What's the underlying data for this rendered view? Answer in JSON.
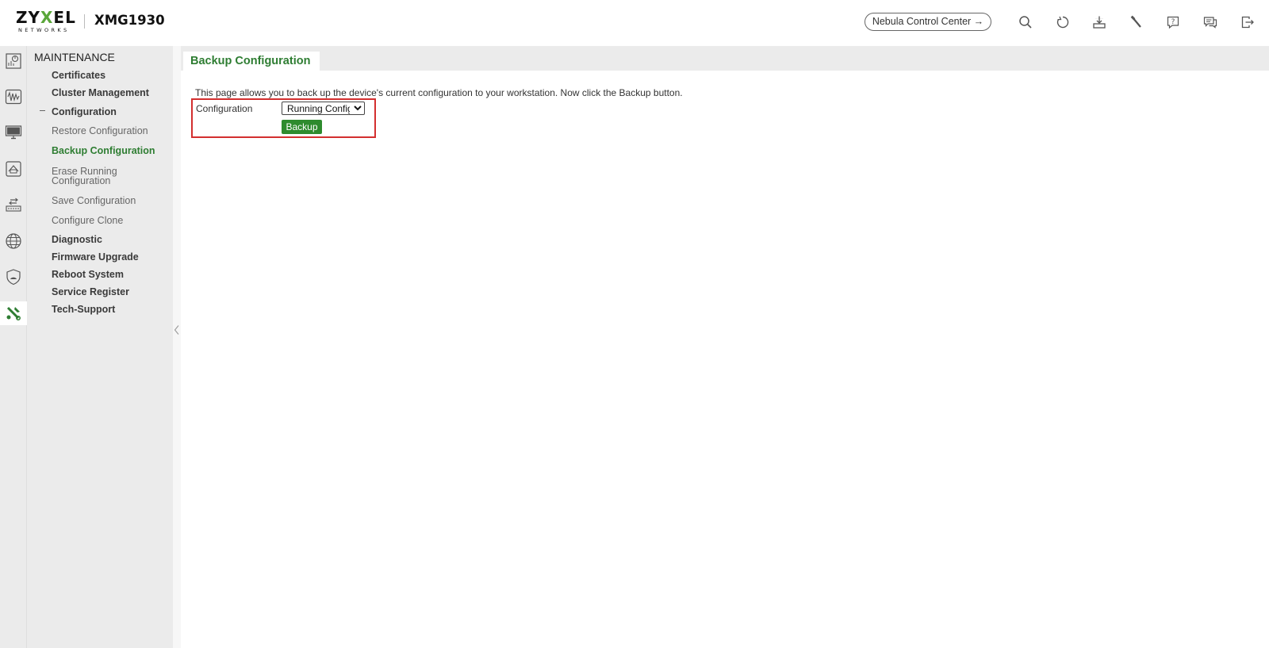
{
  "header": {
    "logo_text": "ZYXEL",
    "logo_sub": "NETWORKS",
    "model": "XMG1930",
    "nebula_label": "Nebula Control Center",
    "nebula_arrow": "→",
    "icons": [
      "search-icon",
      "refresh-icon",
      "save-icon",
      "tools-icon",
      "help-icon",
      "feedback-icon",
      "logout-icon"
    ]
  },
  "iconbar": {
    "items": [
      "dashboard-icon",
      "monitor-icon",
      "display-icon",
      "network-icon",
      "port-icon",
      "globe-icon",
      "security-shield-icon",
      "maintenance-icon"
    ],
    "active": "maintenance-icon"
  },
  "sidebar": {
    "title": "MAINTENANCE",
    "items": [
      {
        "label": "Certificates"
      },
      {
        "label": "Cluster Management"
      },
      {
        "label": "Configuration"
      },
      {
        "label": "Restore Configuration"
      },
      {
        "label": "Backup Configuration"
      },
      {
        "label": "Erase Running"
      },
      {
        "label": "Configuration"
      },
      {
        "label": "Save Configuration"
      },
      {
        "label": "Configure Clone"
      },
      {
        "label": "Diagnostic"
      },
      {
        "label": "Firmware Upgrade"
      },
      {
        "label": "Reboot System"
      },
      {
        "label": "Service Register"
      },
      {
        "label": "Tech-Support"
      }
    ]
  },
  "main": {
    "tab_label": "Backup Configuration",
    "description": "This page allows you to back up the device's current configuration to your workstation. Now click the Backup button.",
    "config_label": "Configuration",
    "config_selected": "Running Config",
    "backup_button": "Backup"
  },
  "colors": {
    "accent_green": "#2e7d32",
    "button_green": "#2e8b2e",
    "highlight_red": "#d32f2f",
    "sidebar_bg": "#ebebeb"
  }
}
